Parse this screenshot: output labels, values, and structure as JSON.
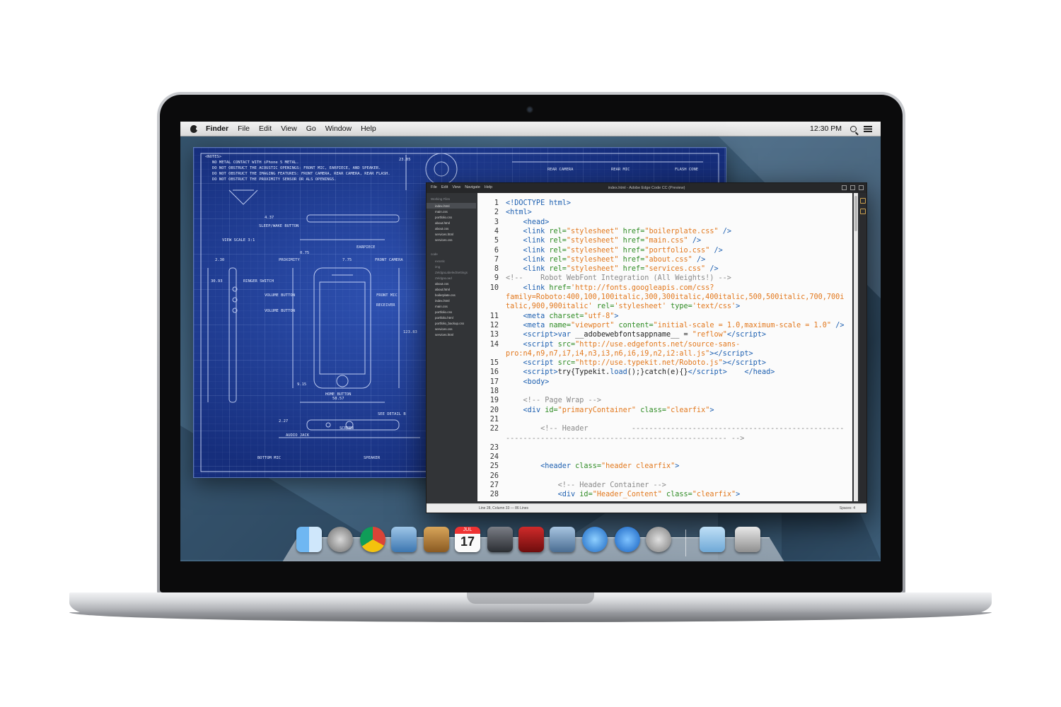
{
  "menubar": {
    "app": "Finder",
    "items": [
      "File",
      "Edit",
      "View",
      "Go",
      "Window",
      "Help"
    ],
    "clock": "12:30 PM"
  },
  "blueprint": {
    "notes_title": "<NOTES>",
    "notes": [
      "NO METAL CONTACT WITH iPhone 5 METAL.",
      "DO NOT OBSTRUCT THE ACOUSTIC OPENINGS: FRONT MIC, EARPIECE, AND SPEAKER.",
      "DO NOT OBSTRUCT THE IMAGING FEATURES: FRONT CAMERA, REAR CAMERA, REAR FLASH.",
      "DO NOT OBSTRUCT THE PROXIMITY SENSOR OR ALS OPENINGS."
    ],
    "labels": [
      "SLEEP/WAKE BUTTON",
      "VIEW SCALE 3:1",
      "PROXIMITY",
      "FRONT CAMERA",
      "EARPIECE",
      "RINGER SWITCH",
      "VOLUME BUTTON",
      "VOLUME BUTTON",
      "FRONT MIC",
      "RECEIVER",
      "HOME BUTTON",
      "SCREEN",
      "AUDIO JACK",
      "BOTTOM MIC",
      "SPEAKER",
      "SEE DETAIL B",
      "FLASH CONE",
      "REAR CAMERA",
      "REAR MIC"
    ],
    "dims": [
      "23.05",
      "58.57",
      "123.83",
      "4.37",
      "9.15",
      "2.30",
      "30.93",
      "7.75",
      "0.75",
      "2.27"
    ]
  },
  "editor": {
    "title": "index.html - Adobe Edge Code CC (Preview)",
    "menu": [
      "File",
      "Edit",
      "View",
      "Navigate",
      "Help"
    ],
    "sidebar_head": "Working Files",
    "working_files": [
      "index.html",
      "main.css",
      "portfolio.css",
      "about.html",
      "about.css",
      "services.html",
      "services.css"
    ],
    "project_head": "code",
    "project_files": [
      "exsotic",
      "img",
      "ZeldgaLabeledSettings",
      "ZeldgaLoad",
      "about.css",
      "about.html",
      "boilerplate.css",
      "index.html",
      "main.css",
      "portfolio.css",
      "portfolio.html",
      "portfolio_backup.css",
      "services.css",
      "services.html"
    ],
    "status_left": "Line 28, Column 33 — 86 Lines",
    "status_right": "Spaces: 4",
    "lines": [
      {
        "n": "1",
        "html": "<span class=\"t\">&lt;!DOCTYPE html&gt;</span>"
      },
      {
        "n": "2",
        "html": "<span class=\"t\">&lt;html&gt;</span>"
      },
      {
        "n": "3",
        "html": "    <span class=\"t\">&lt;head&gt;</span>"
      },
      {
        "n": "4",
        "html": "    <span class=\"t\">&lt;link</span> <span class=\"a\">rel=</span><span class=\"s\">\"stylesheet\"</span> <span class=\"a\">href=</span><span class=\"s\">\"boilerplate.css\"</span> <span class=\"t\">/&gt;</span>"
      },
      {
        "n": "5",
        "html": "    <span class=\"t\">&lt;link</span> <span class=\"a\">rel=</span><span class=\"s\">\"stylesheet\"</span> <span class=\"a\">href=</span><span class=\"s\">\"main.css\"</span> <span class=\"t\">/&gt;</span>"
      },
      {
        "n": "6",
        "html": "    <span class=\"t\">&lt;link</span> <span class=\"a\">rel=</span><span class=\"s\">\"stylesheet\"</span> <span class=\"a\">href=</span><span class=\"s\">\"portfolio.css\"</span> <span class=\"t\">/&gt;</span>"
      },
      {
        "n": "7",
        "html": "    <span class=\"t\">&lt;link</span> <span class=\"a\">rel=</span><span class=\"s\">\"stylesheet\"</span> <span class=\"a\">href=</span><span class=\"s\">\"about.css\"</span> <span class=\"t\">/&gt;</span>"
      },
      {
        "n": "8",
        "html": "    <span class=\"t\">&lt;link</span> <span class=\"a\">rel=</span><span class=\"s\">\"stylesheet\"</span> <span class=\"a\">href=</span><span class=\"s\">\"services.css\"</span> <span class=\"t\">/&gt;</span>"
      },
      {
        "n": "9",
        "html": "<span class=\"c\">&lt;!--    Robot WebFont Integration (All Weights!) --&gt;</span>"
      },
      {
        "n": "10",
        "html": "    <span class=\"t\">&lt;link</span> <span class=\"a\">href=</span><span class=\"s\">'http://fonts.googleapis.com/css?</span>"
      },
      {
        "n": "",
        "html": "<span class=\"s\">family=Roboto:400,100,100italic,300,300italic,400italic,500,500italic,700,700i</span>"
      },
      {
        "n": "",
        "html": "<span class=\"s\">talic,900,900italic'</span> <span class=\"a\">rel=</span><span class=\"s\">'stylesheet'</span> <span class=\"a\">type=</span><span class=\"s\">'text/css'</span><span class=\"t\">&gt;</span>"
      },
      {
        "n": "11",
        "html": "    <span class=\"t\">&lt;meta</span> <span class=\"a\">charset=</span><span class=\"s\">\"utf-8\"</span><span class=\"t\">&gt;</span>"
      },
      {
        "n": "12",
        "html": "    <span class=\"t\">&lt;meta</span> <span class=\"a\">name=</span><span class=\"s\">\"viewport\"</span> <span class=\"a\">content=</span><span class=\"s\">\"initial-scale = 1.0,maximum-scale = 1.0\"</span> <span class=\"t\">/&gt;</span>"
      },
      {
        "n": "13",
        "html": "    <span class=\"t\">&lt;script&gt;</span><span class=\"t\">var</span> __adobewebfontsappname__ = <span class=\"s\">\"reflow\"</span><span class=\"t\">&lt;/script&gt;</span>"
      },
      {
        "n": "14",
        "html": "    <span class=\"t\">&lt;script</span> <span class=\"a\">src=</span><span class=\"s\">\"http://use.edgefonts.net/source-sans-</span>"
      },
      {
        "n": "",
        "html": "<span class=\"s\">pro:n4,n9,n7,i7,i4,n3,i3,n6,i6,i9,n2,i2:all.js\"</span><span class=\"t\">&gt;&lt;/script&gt;</span>"
      },
      {
        "n": "15",
        "html": "    <span class=\"t\">&lt;script</span> <span class=\"a\">src=</span><span class=\"s\">\"http://use.typekit.net/Roboto.js\"</span><span class=\"t\">&gt;&lt;/script&gt;</span>"
      },
      {
        "n": "16",
        "html": "    <span class=\"t\">&lt;script&gt;</span>try{Typekit.<span class=\"t\">load</span>();}catch(e){}<span class=\"t\">&lt;/script&gt;</span>    <span class=\"t\">&lt;/head&gt;</span>"
      },
      {
        "n": "17",
        "html": "    <span class=\"t\">&lt;body&gt;</span>"
      },
      {
        "n": "18",
        "html": ""
      },
      {
        "n": "19",
        "html": "    <span class=\"c\">&lt;!-- Page Wrap --&gt;</span>"
      },
      {
        "n": "20",
        "html": "    <span class=\"t\">&lt;div</span> <span class=\"a\">id=</span><span class=\"s\">\"primaryContainer\"</span> <span class=\"a\">class=</span><span class=\"s\">\"clearfix\"</span><span class=\"t\">&gt;</span>"
      },
      {
        "n": "21",
        "html": ""
      },
      {
        "n": "22",
        "html": "        <span class=\"c\">&lt;!-- Header          -------------------------------------------------</span>"
      },
      {
        "n": "",
        "html": "<span class=\"c\">--------------------------------------------------- --&gt;</span>"
      },
      {
        "n": "23",
        "html": ""
      },
      {
        "n": "24",
        "html": ""
      },
      {
        "n": "25",
        "html": "        <span class=\"t\">&lt;header</span> <span class=\"a\">class=</span><span class=\"s\">\"header clearfix\"</span><span class=\"t\">&gt;</span>"
      },
      {
        "n": "26",
        "html": ""
      },
      {
        "n": "27",
        "html": "            <span class=\"c\">&lt;!-- Header Container --&gt;</span>"
      },
      {
        "n": "28",
        "html": "            <span class=\"t\">&lt;div</span> <span class=\"a\">id=</span><span class=\"s\">\"Header_Content\"</span> <span class=\"a\">class=</span><span class=\"s\">\"clearfix\"</span><span class=\"t\">&gt;</span>"
      }
    ]
  },
  "dock": {
    "items": [
      {
        "name": "finder-icon",
        "bg": "linear-gradient(90deg,#6fb7f2 50%,#cfe7fb 50%)"
      },
      {
        "name": "launchpad-icon",
        "bg": "radial-gradient(#d8d8d8,#6c6c6c)"
      },
      {
        "name": "chrome-icon",
        "bg": "conic-gradient(#db4437 0 33%,#f4c20d 0 66%,#0f9d58 0)"
      },
      {
        "name": "mail-icon",
        "bg": "linear-gradient(#9ec6e8,#3c76b0)"
      },
      {
        "name": "contacts-icon",
        "bg": "linear-gradient(#d8a55a,#8a5a22)"
      },
      {
        "name": "calendar-icon",
        "bg": "linear-gradient(#e33 0 28%,#fafafa 28%)"
      },
      {
        "name": "facetime-icon",
        "bg": "linear-gradient(#7a7d85,#2b2e33)"
      },
      {
        "name": "photo-booth-icon",
        "bg": "linear-gradient(#cf2a2a,#6e0d0d)"
      },
      {
        "name": "iphoto-icon",
        "bg": "linear-gradient(#a7c4e0,#4a6d92)"
      },
      {
        "name": "itunes-icon",
        "bg": "radial-gradient(#8fd0ff,#1a66c2)"
      },
      {
        "name": "app-store-icon",
        "bg": "radial-gradient(#7fc3ff,#1560c0)"
      },
      {
        "name": "system-preferences-icon",
        "bg": "radial-gradient(#e0e0e0,#7d7d7d)"
      },
      {
        "name": "downloads-folder-icon",
        "bg": "linear-gradient(#bfe0f7,#6fa8d6)"
      },
      {
        "name": "trash-icon",
        "bg": "linear-gradient(#e8e8e8,#8f8f8f)"
      }
    ],
    "calendar_month": "JUL",
    "calendar_day": "17"
  }
}
